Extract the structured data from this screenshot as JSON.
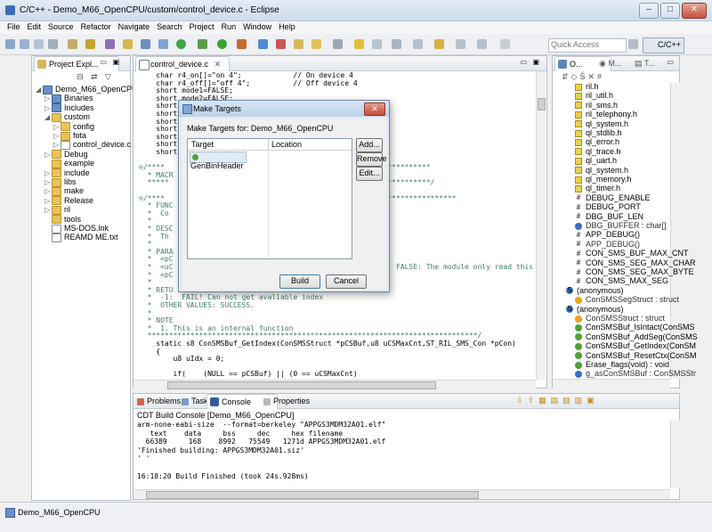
{
  "window": {
    "title": "C/C++ - Demo_M66_OpenCPU/custom/control_device.c - Eclipse"
  },
  "menu": [
    "File",
    "Edit",
    "Source",
    "Refactor",
    "Navigate",
    "Search",
    "Project",
    "Run",
    "Window",
    "Help"
  ],
  "toolbar": {
    "quick_access_placeholder": "Quick Access",
    "perspective_label": "C/C++"
  },
  "project_explorer": {
    "tab_label": "Project Expl...",
    "items": [
      {
        "label": "Demo_M66_OpenCPU",
        "type": "project",
        "arrow": "◢",
        "indent": 0
      },
      {
        "label": "Binaries",
        "type": "binaries",
        "arrow": "▷",
        "indent": 1
      },
      {
        "label": "Includes",
        "type": "includes",
        "arrow": "▷",
        "indent": 1
      },
      {
        "label": "custom",
        "type": "folder",
        "arrow": "◢",
        "indent": 1
      },
      {
        "label": "config",
        "type": "folder",
        "arrow": "▷",
        "indent": 2
      },
      {
        "label": "fota",
        "type": "folder",
        "arrow": "▷",
        "indent": 2
      },
      {
        "label": "control_device.c",
        "type": "file",
        "arrow": "▷",
        "indent": 2
      },
      {
        "label": "Debug",
        "type": "folder",
        "arrow": "▷",
        "indent": 1
      },
      {
        "label": "example",
        "type": "folder",
        "arrow": "",
        "indent": 1
      },
      {
        "label": "include",
        "type": "folder",
        "arrow": "▷",
        "indent": 1
      },
      {
        "label": "libs",
        "type": "folder",
        "arrow": "▷",
        "indent": 1
      },
      {
        "label": "make",
        "type": "folder",
        "arrow": "▷",
        "indent": 1
      },
      {
        "label": "Release",
        "type": "folder",
        "arrow": "▷",
        "indent": 1
      },
      {
        "label": "ril",
        "type": "folder",
        "arrow": "▷",
        "indent": 1
      },
      {
        "label": "tools",
        "type": "folder",
        "arrow": "",
        "indent": 1
      },
      {
        "label": "MS-DOS.lnk",
        "type": "file",
        "arrow": "",
        "indent": 1
      },
      {
        "label": "REAMD ME.txt",
        "type": "file",
        "arrow": "",
        "indent": 1
      }
    ]
  },
  "editor": {
    "tab_label": "control_device.c",
    "lines": [
      {
        "t": "    char r4_on[]=\"on 4\";            // On device 4"
      },
      {
        "t": "    char r4_off[]=\"off 4\";          // Off device 4"
      },
      {
        "t": "    short mode1=FALSE;"
      },
      {
        "t": "    short mode2=FALSE;"
      },
      {
        "t": "    short"
      },
      {
        "t": "    short"
      },
      {
        "t": "    short"
      },
      {
        "t": "    short"
      },
      {
        "t": "    short"
      },
      {
        "t": "    short"
      },
      {
        "t": "    short"
      },
      {
        "t": ""
      },
      {
        "t": "⊖/****                                                    **********"
      },
      {
        "t": "  * MACR"
      },
      {
        "t": "  *****                                                   **********/"
      },
      {
        "t": ""
      },
      {
        "t": "⊖/****                                                    ****************"
      },
      {
        "t": "  * FUNC"
      },
      {
        "t": "  *  Co"
      },
      {
        "t": "  *"
      },
      {
        "t": "  * DESC"
      },
      {
        "t": "  *  Th"
      },
      {
        "t": "  *"
      },
      {
        "t": "  * PARA"
      },
      {
        "t": "  *  <pC"
      },
      {
        "t": "  *  <uC                                                  ; FALSE: The module only read this SMS."
      },
      {
        "t": "  *  <pC"
      },
      {
        "t": "  *"
      },
      {
        "t": "  * RETU"
      },
      {
        "t": "  *  -1:  FAIL! Can not get avaliable index"
      },
      {
        "t": "  *  OTHER VALUES: SUCCESS."
      },
      {
        "t": "  *"
      },
      {
        "t": "  * NOTE"
      },
      {
        "t": "  *  1. This is an internal function"
      },
      {
        "t": "  *****************************************************************************/"
      },
      {
        "t": "    static s8 ConSMSBuf_GetIndex(ConSMSStruct *pCSBuf,u8 uCSMaxCnt,ST_RIL_SMS_Con *pCon)"
      },
      {
        "t": "    {"
      },
      {
        "t": "        u8 uIdx = 0;"
      },
      {
        "t": ""
      },
      {
        "t": "        if(    (NULL == pCSBuf) || (0 == uCSMaxCnt)"
      }
    ]
  },
  "dialog": {
    "title": "Make Targets",
    "subtitle": "Make Targets for: Demo_M66_OpenCPU",
    "col_target": "Target",
    "col_location": "Location",
    "targets": [
      "GenBinHeader"
    ],
    "add_label": "Add...",
    "remove_label": "Remove",
    "edit_label": "Edit...",
    "build_label": "Build",
    "cancel_label": "Cancel"
  },
  "outline": {
    "tab1": "O...",
    "tab2": "M...",
    "tab3": "T...",
    "items": [
      {
        "label": "ril.h",
        "kind": "include"
      },
      {
        "label": "ril_util.h",
        "kind": "include"
      },
      {
        "label": "ril_sms.h",
        "kind": "include"
      },
      {
        "label": "ril_telephony.h",
        "kind": "include"
      },
      {
        "label": "ql_system.h",
        "kind": "include"
      },
      {
        "label": "ql_stdlib.h",
        "kind": "include"
      },
      {
        "label": "ql_error.h",
        "kind": "include"
      },
      {
        "label": "ql_trace.h",
        "kind": "include"
      },
      {
        "label": "ql_uart.h",
        "kind": "include"
      },
      {
        "label": "ql_system.h",
        "kind": "include"
      },
      {
        "label": "ql_memory.h",
        "kind": "include"
      },
      {
        "label": "ql_timer.h",
        "kind": "include"
      },
      {
        "label": "DEBUG_ENABLE",
        "kind": "macro"
      },
      {
        "label": "DEBUG_PORT",
        "kind": "macro"
      },
      {
        "label": "DBG_BUF_LEN",
        "kind": "macro"
      },
      {
        "label": "DBG_BUFFER : char[]",
        "kind": "var"
      },
      {
        "label": "APP_DEBUG()",
        "kind": "macro"
      },
      {
        "label": "APP_DEBUG()",
        "kind": "macro"
      },
      {
        "label": "CON_SMS_BUF_MAX_CNT",
        "kind": "macro"
      },
      {
        "label": "CON_SMS_SEG_MAX_CHAR",
        "kind": "macro"
      },
      {
        "label": "CON_SMS_SEG_MAX_BYTE",
        "kind": "macro"
      },
      {
        "label": "CON_SMS_MAX_SEG",
        "kind": "macro"
      },
      {
        "label": "(anonymous)",
        "kind": "struct"
      },
      {
        "label": "ConSMSSegStruct : struct",
        "kind": "typedef"
      },
      {
        "label": "(anonymous)",
        "kind": "struct"
      },
      {
        "label": "ConSMSStruct : struct",
        "kind": "typedef"
      },
      {
        "label": "ConSMSBuf_IsIntact(ConSMS",
        "kind": "func"
      },
      {
        "label": "ConSMSBuf_AddSeg(ConSMS",
        "kind": "func"
      },
      {
        "label": "ConSMSBuf_GetIndex(ConSM",
        "kind": "func"
      },
      {
        "label": "ConSMSBuf_ResetCtx(ConSM",
        "kind": "func"
      },
      {
        "label": "Erase_flags(void) : void",
        "kind": "func"
      },
      {
        "label": "g_asConSMSBuf : ConSMSStr",
        "kind": "var"
      }
    ]
  },
  "console": {
    "tabs": [
      "Problems",
      "Tasks",
      "Console",
      "Properties"
    ],
    "header": "CDT Build Console [Demo_M66_OpenCPU]",
    "lines": [
      "arm-none-eabi-size  --format=berkeley \"APPGS3MDM32A01.elf\"",
      "   text    data     bss     dec     hex filename",
      "  66389     168    8992   75549   1271d APPGS3MDM32A01.elf",
      "'Finished building: APPGS3MDM32A01.siz'",
      "' '",
      "",
      "16:18:20 Build Finished (took 24s.928ms)"
    ]
  },
  "status": {
    "text": "Demo_M66_OpenCPU"
  }
}
